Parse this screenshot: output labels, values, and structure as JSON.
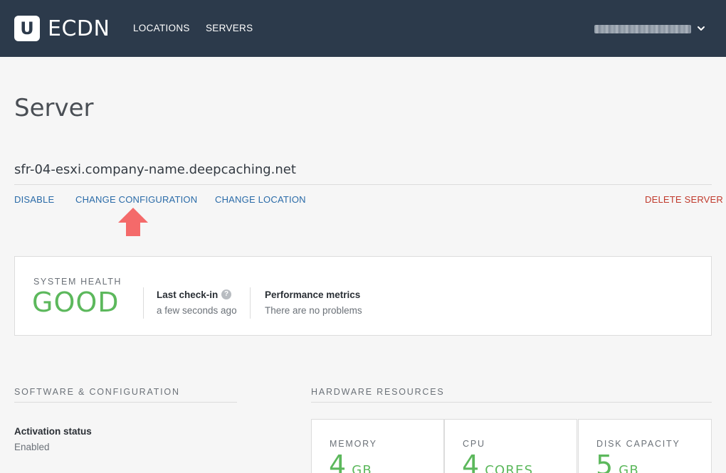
{
  "header": {
    "logo_letter": "U",
    "brand": "ECDN",
    "nav": [
      {
        "label": "LOCATIONS"
      },
      {
        "label": "SERVERS"
      }
    ],
    "user_menu_icon": "chevron-down-icon"
  },
  "page": {
    "title": "Server",
    "server_name": "sfr-04-esxi.company-name.deepcaching.net"
  },
  "actions": {
    "disable": "DISABLE",
    "change_configuration": "CHANGE CONFIGURATION",
    "change_location": "CHANGE LOCATION",
    "delete_server": "DELETE SERVER"
  },
  "health": {
    "label": "SYSTEM HEALTH",
    "value": "GOOD",
    "last_checkin_title": "Last check-in",
    "last_checkin_help": "?",
    "last_checkin_value": "a few seconds ago",
    "metrics_title": "Performance metrics",
    "metrics_value": "There are no problems"
  },
  "software": {
    "heading": "SOFTWARE & CONFIGURATION",
    "activation_label": "Activation status",
    "activation_value": "Enabled"
  },
  "hardware": {
    "heading": "HARDWARE RESOURCES",
    "resources": [
      {
        "title": "MEMORY",
        "value": "4",
        "unit": "GB"
      },
      {
        "title": "CPU",
        "value": "4",
        "unit": "CORES"
      },
      {
        "title": "DISK CAPACITY",
        "value": "5",
        "unit": "GB"
      }
    ]
  },
  "colors": {
    "topbar": "#2c3a4b",
    "link": "#2a6ba8",
    "danger": "#c0392b",
    "good": "#5cb85c",
    "annotation_arrow": "#f46a6a"
  }
}
